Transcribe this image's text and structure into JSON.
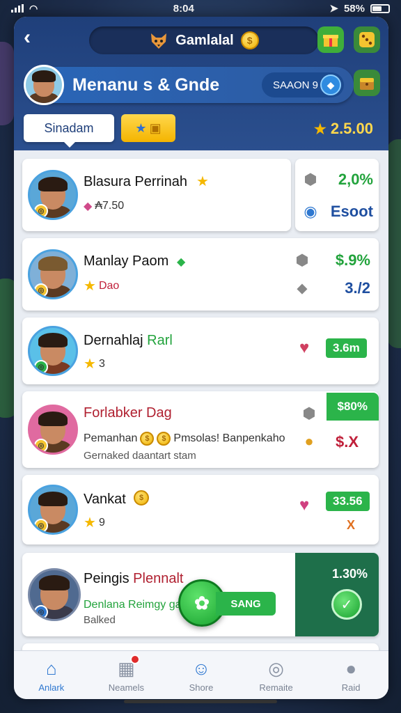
{
  "status_bar": {
    "time": "8:04",
    "battery": "58%"
  },
  "header": {
    "title": "Gamlalal",
    "profile_name": "Menanu s & Gnde",
    "season_label": "SAAON 9",
    "rank_label": "Sinadam",
    "score": "2.5.00"
  },
  "players": [
    {
      "name": "Blasura Perrinah",
      "sub": "₳7.50",
      "stat1": "2,0%",
      "stat2": "Esoot"
    },
    {
      "name": "Manlay Paom",
      "sub": "Dao",
      "stat1": "$.9%",
      "stat2": "3./2"
    },
    {
      "name": "Dernahlaj",
      "name_accent": "Rarl",
      "sub": "3",
      "stat1": "3.6m"
    },
    {
      "name": "Forlabker Dag",
      "sub": "Pemanhan",
      "sub_tail": "Pmsolas! Banpenkaho",
      "sub2": "Gernaked daantart stam",
      "stat1": "$80%",
      "stat2": "$.X"
    },
    {
      "name": "Vankat",
      "sub": "9",
      "stat1": "33.56",
      "stat2": "X"
    },
    {
      "name": "Peingis",
      "name_accent": "Plennalt",
      "sub": "Denlana Reimgy gar",
      "sub2": "Balked",
      "stat1": "1.30%"
    }
  ],
  "fab": {
    "label": "SANG"
  },
  "tabs": [
    {
      "label": "Anlark",
      "icon": "home-icon"
    },
    {
      "label": "Neamels",
      "icon": "gift-icon"
    },
    {
      "label": "Shore",
      "icon": "person-icon"
    },
    {
      "label": "Remaite",
      "icon": "settings-icon"
    },
    {
      "label": "Raid",
      "icon": "profile-icon"
    }
  ]
}
